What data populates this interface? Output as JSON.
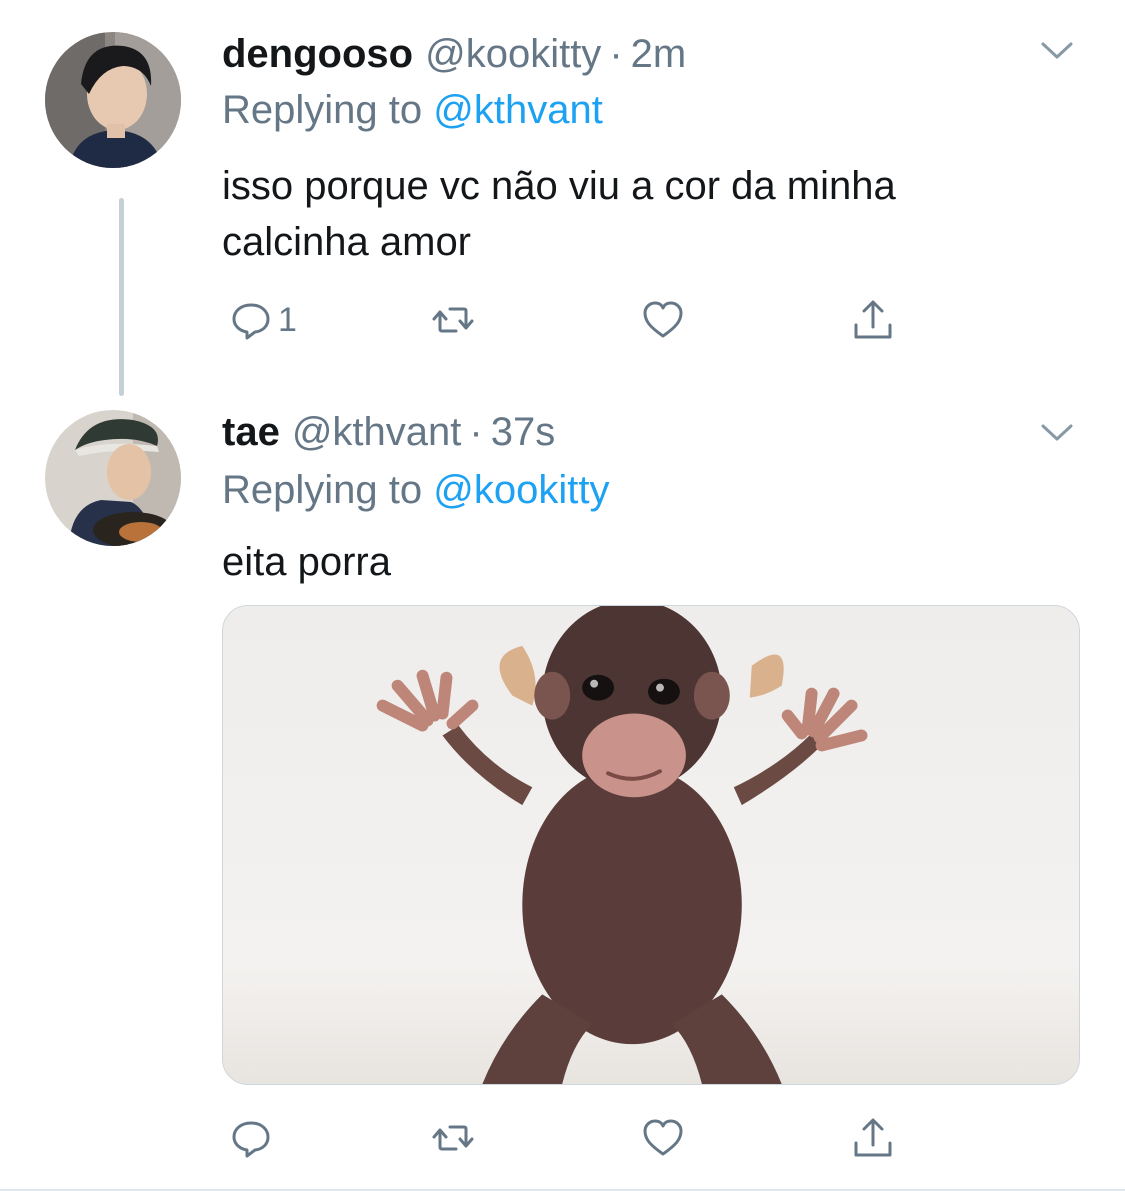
{
  "tweets": [
    {
      "display_name": "dengooso",
      "handle": "@kookitty",
      "separator": "·",
      "time": "2m",
      "replying_prefix": "Replying to",
      "replying_to": "@kthvant",
      "text": "isso porque vc não viu a cor da minha calcinha amor",
      "reply_count": "1",
      "has_media": false
    },
    {
      "display_name": "tae",
      "handle": "@kthvant",
      "separator": "·",
      "time": "37s",
      "replying_prefix": "Replying to",
      "replying_to": "@kookitty",
      "text": "eita porra",
      "reply_count": "",
      "has_media": true
    }
  ],
  "icons": {
    "reply": "reply-icon",
    "retweet": "retweet-icon",
    "like": "heart-icon",
    "share": "share-icon",
    "caret": "chevron-down-icon"
  },
  "colors": {
    "link": "#1da1f2",
    "secondary_text": "#657786",
    "primary_text": "#14171a",
    "thread_line": "#c4cfd6"
  }
}
